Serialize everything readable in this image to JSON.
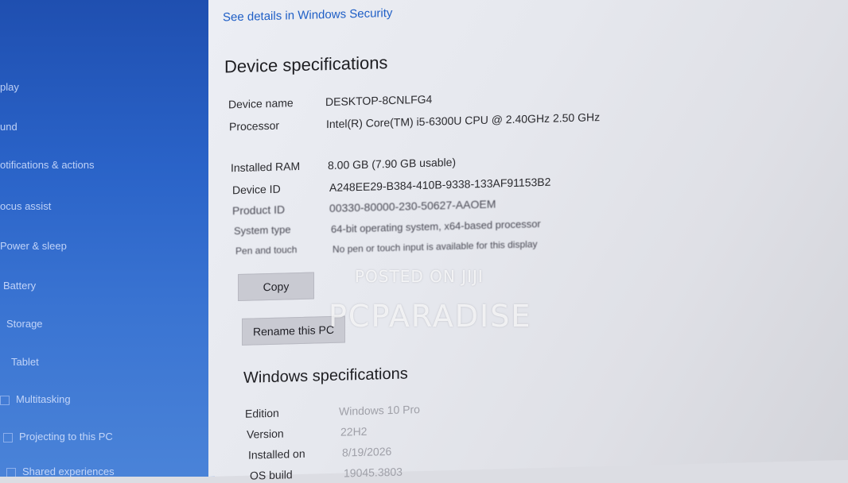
{
  "sidebar": {
    "items": [
      {
        "label": "play"
      },
      {
        "label": "und"
      },
      {
        "label": "otifications & actions"
      },
      {
        "label": "ocus assist"
      },
      {
        "label": "Power & sleep"
      },
      {
        "label": "Battery"
      },
      {
        "label": "Storage"
      },
      {
        "label": "Tablet"
      },
      {
        "label": "Multitasking"
      },
      {
        "label": "Projecting to this PC"
      },
      {
        "label": "Shared experiences"
      }
    ]
  },
  "security_link": "See details in Windows Security",
  "device_specs": {
    "heading": "Device specifications",
    "rows": [
      {
        "label": "Device name",
        "value": "DESKTOP-8CNLFG4"
      },
      {
        "label": "Processor",
        "value": "Intel(R) Core(TM) i5-6300U CPU @ 2.40GHz   2.50 GHz"
      },
      {
        "label": "Installed RAM",
        "value": "8.00 GB (7.90 GB usable)"
      },
      {
        "label": "Device ID",
        "value": "A248EE29-B384-410B-9338-133AF91153B2"
      },
      {
        "label": "Product ID",
        "value": "00330-80000-230-50627-AAOEM"
      },
      {
        "label": "System type",
        "value": "64-bit operating system, x64-based processor"
      },
      {
        "label": "Pen and touch",
        "value": "No pen or touch input is available for this display"
      }
    ],
    "copy_button": "Copy",
    "rename_button": "Rename this PC"
  },
  "windows_specs": {
    "heading": "Windows specifications",
    "rows": [
      {
        "label": "Edition",
        "value": "Windows 10 Pro"
      },
      {
        "label": "Version",
        "value": "22H2"
      },
      {
        "label": "Installed on",
        "value": "8/19/2026"
      },
      {
        "label": "OS build",
        "value": "19045.3803"
      }
    ]
  },
  "watermark": {
    "line1": "POSTED ON JIJI",
    "line2": "PCPARADISE"
  }
}
